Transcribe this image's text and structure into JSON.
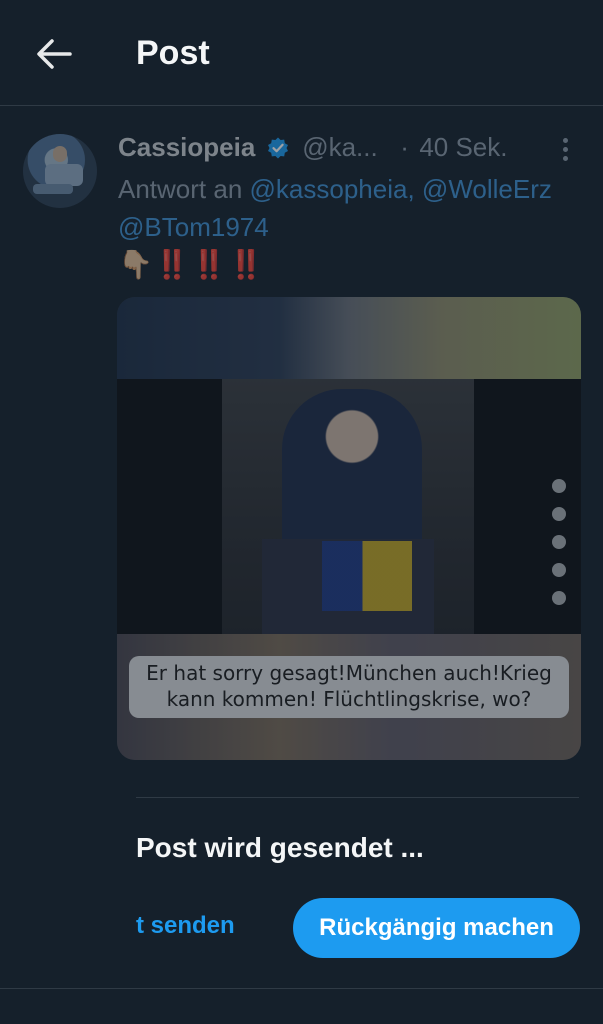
{
  "header": {
    "title": "Post",
    "back_icon": "arrow-left-icon"
  },
  "tweet": {
    "author_name": "Cassiopeia",
    "handle": "@ka...",
    "separator": "·",
    "time": "40 Sek.",
    "reply_prefix": "Antwort an",
    "reply_mentions": [
      "@kassopheia,",
      "@WolleErz",
      "@BTom1974"
    ],
    "emoji": "👇🏼",
    "exclamations": "‼️‼️‼️",
    "media_caption_line1": "Er hat sorry gesagt!München auch!Krieg",
    "media_caption_line2": "kann kommen! Flüchtlingskrise, wo?"
  },
  "sending": {
    "status": "Post wird gesendet ...",
    "send_now_label": "t senden",
    "undo_label": "Rückgängig machen"
  },
  "colors": {
    "background": "#15202b",
    "accent": "#1d9bf0",
    "mention": "#3f8fd0"
  }
}
